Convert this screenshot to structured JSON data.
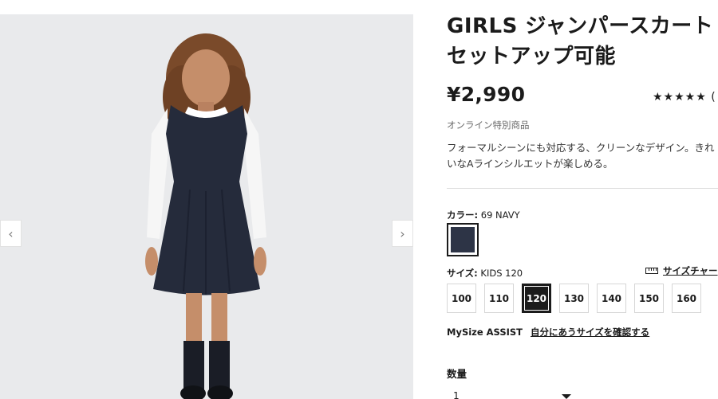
{
  "product": {
    "title_line1": "GIRLS ジャンパースカート",
    "title_line2": "セットアップ可能",
    "price": "¥2,990",
    "rating_stars": "★★★★★",
    "rating_paren": "(",
    "online_badge": "オンライン特別商品",
    "description": "フォーマルシーンにも対応する、クリーンなデザイン。きれいなAラインシルエットが楽しめる。"
  },
  "color": {
    "label": "カラー:",
    "value": "69 NAVY",
    "swatch_hex": "#2d3446"
  },
  "size": {
    "label": "サイズ:",
    "value": "KIDS 120",
    "chart_link": "サイズチャー",
    "options": [
      "100",
      "110",
      "120",
      "130",
      "140",
      "150",
      "160"
    ],
    "selected": "120"
  },
  "mysize": {
    "label": "MySize ASSIST",
    "link": "自分にあうサイズを確認する"
  },
  "quantity": {
    "label": "数量",
    "value": "1"
  },
  "gallery": {
    "prev_icon": "‹",
    "next_icon": "›"
  }
}
